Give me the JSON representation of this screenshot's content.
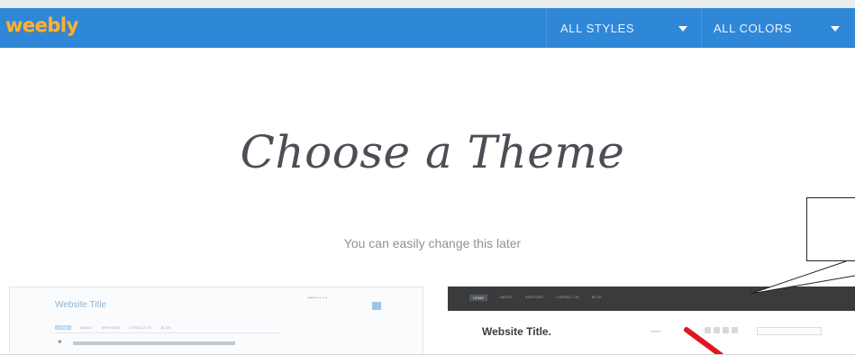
{
  "header": {
    "logo_text": "weebly",
    "styles_dropdown": {
      "label": "ALL STYLES",
      "icon": "caret-down-icon"
    },
    "colors_dropdown": {
      "label": "ALL COLORS",
      "icon": "caret-down-icon"
    }
  },
  "main": {
    "title": "Choose a Theme",
    "subtitle": "You can easily change this later"
  },
  "themes": [
    {
      "site_title": "Website Title",
      "nav": [
        "HOME",
        "ABOUT",
        "SERVICES",
        "CONTACT US",
        "BLOG"
      ]
    },
    {
      "site_title": "Website Title.",
      "nav": [
        "HOME",
        "ABOUT",
        "SERVICES",
        "CONTACT US",
        "BLOG"
      ]
    }
  ],
  "colors": {
    "nav_bg": "#2f87d8",
    "logo": "#f7b13a",
    "annotation_arrow": "#e0161d"
  }
}
